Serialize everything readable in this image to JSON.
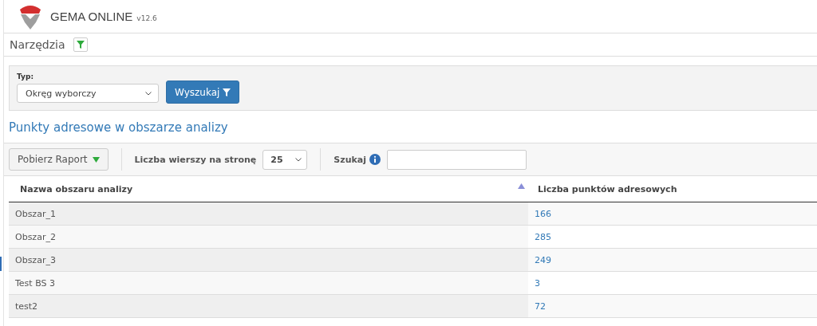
{
  "app": {
    "title": "GEMA ONLINE",
    "version": "v12.6"
  },
  "toolbar": {
    "title": "Narzędzia",
    "filter_active": true
  },
  "filter_panel": {
    "label": "Typ:",
    "select_value": "Okręg wyborczy",
    "search_button": "Wyszukaj"
  },
  "section_title": "Punkty adresowe w obszarze analizy",
  "table_toolbar": {
    "report_button": "Pobierz Raport",
    "rows_label": "Liczba wierszy na stronę",
    "rows_value": "25",
    "search_label": "Szukaj"
  },
  "table": {
    "columns": [
      {
        "label": "Nazwa obszaru analizy",
        "sorted_ascending": true
      },
      {
        "label": "Liczba punktów adresowych",
        "sorted_ascending": false
      }
    ],
    "rows": [
      {
        "cells": [
          "Obszar_1",
          "166"
        ]
      },
      {
        "cells": [
          "Obszar_2",
          "285"
        ]
      },
      {
        "cells": [
          "Obszar_3",
          "249"
        ]
      },
      {
        "cells": [
          "Test BS 3",
          "3"
        ]
      },
      {
        "cells": [
          "test2",
          "72"
        ]
      }
    ]
  }
}
